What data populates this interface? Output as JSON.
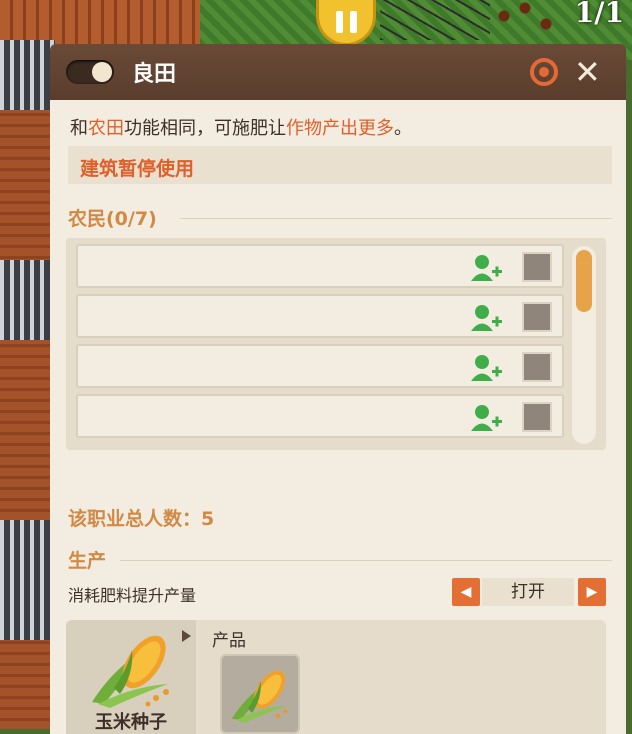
{
  "hud": {
    "counter": "1/1"
  },
  "panel": {
    "title": "良田",
    "description": {
      "p1": "和",
      "p2": "农田",
      "p3": "功能相同，可施肥让",
      "p4": "作物产出更多",
      "p5": "。"
    },
    "warning": "建筑暂停使用",
    "workers": {
      "title": "农民(0/7)",
      "slots": [
        {
          "id": 1
        },
        {
          "id": 2
        },
        {
          "id": 3
        },
        {
          "id": 4
        }
      ]
    },
    "total_label": "该职业总人数：5",
    "production": {
      "title": "生产",
      "option_label": "消耗肥料提升产量",
      "option_state": "打开",
      "input_name": "玉米种子",
      "output_label": "产品"
    }
  },
  "colors": {
    "accent": "#e0602b",
    "section": "#d08a45",
    "header": "#5a3d2c",
    "panel_bg": "#f3ece0"
  },
  "icons": [
    "pause-icon",
    "toggle-switch",
    "target-icon",
    "close-icon",
    "add-worker-icon",
    "checkbox",
    "corn-seed-icon",
    "corn-icon",
    "left-arrow-icon",
    "right-arrow-icon"
  ]
}
